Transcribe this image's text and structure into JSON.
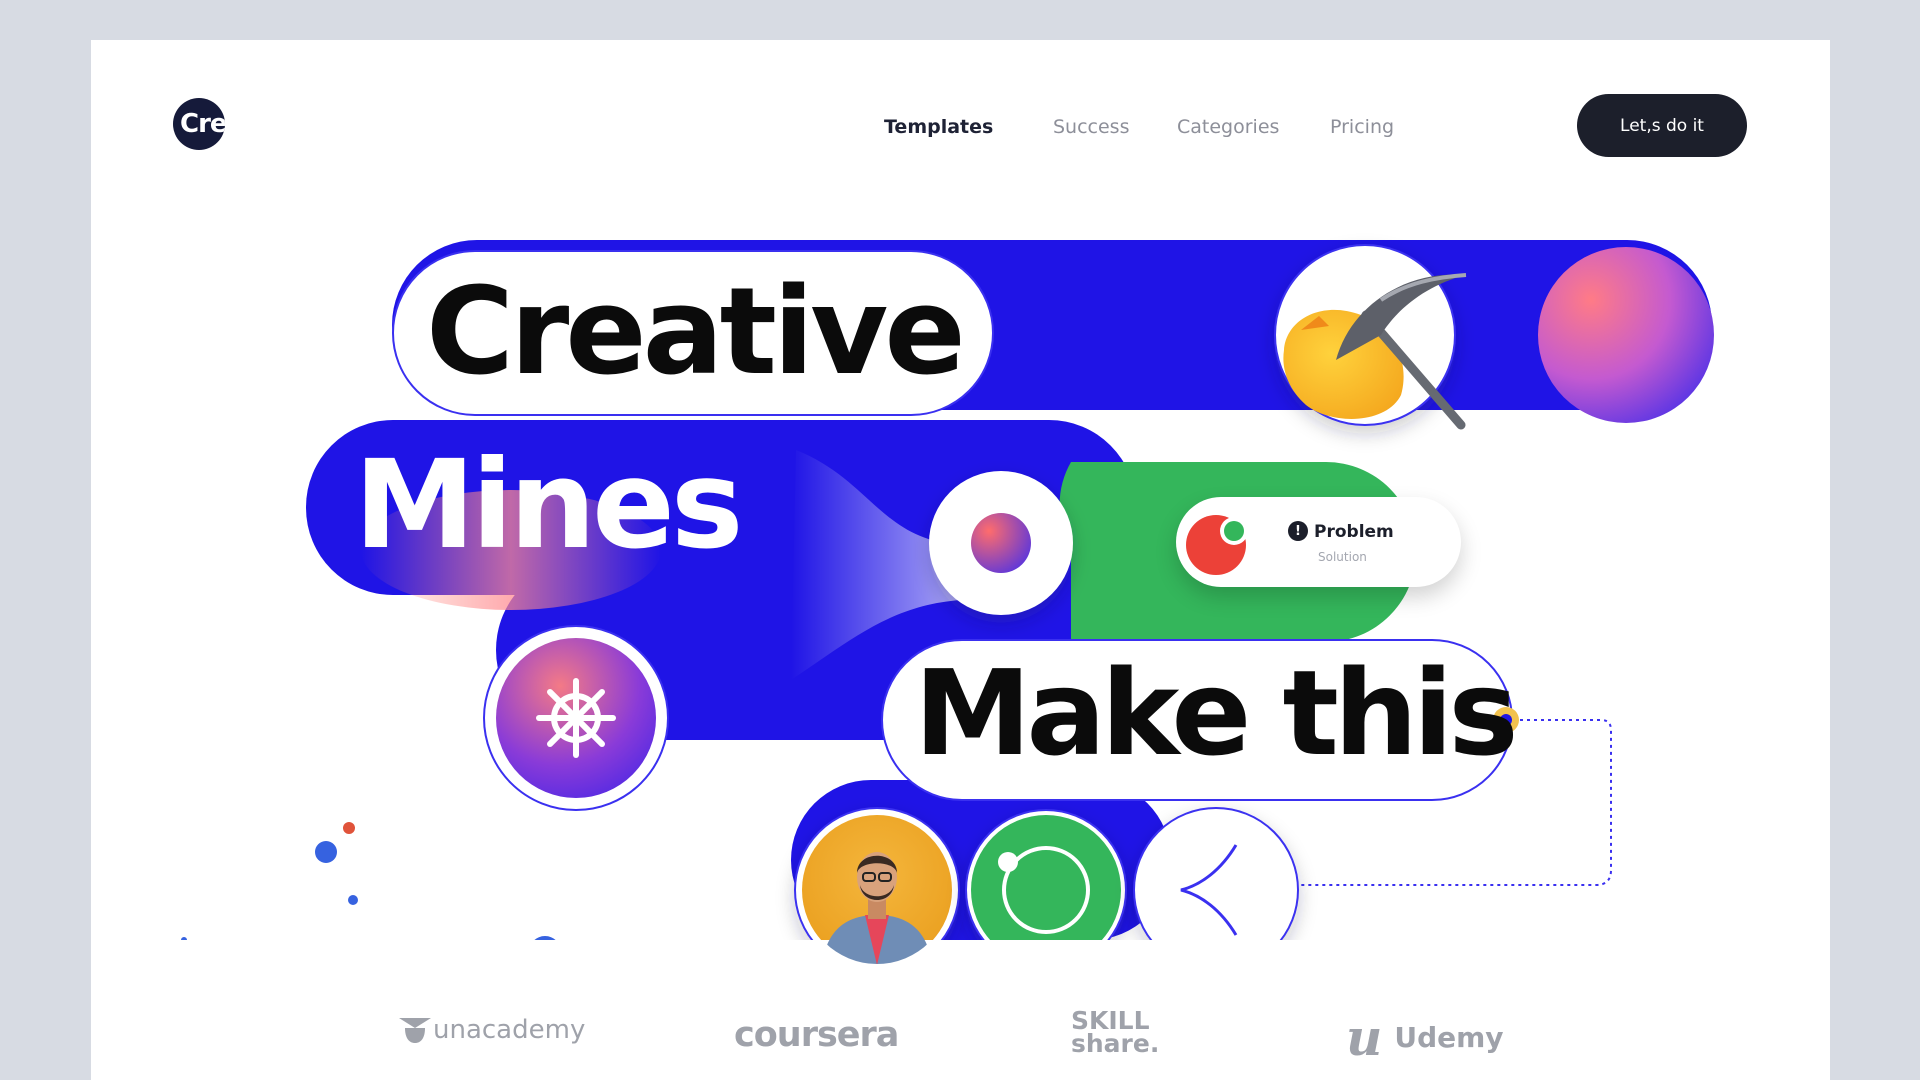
{
  "nav": {
    "logo_text": "Cre",
    "links": [
      "Templates",
      "Success",
      "Categories",
      "Pricing"
    ],
    "active": "Templates",
    "cta": "Let,s do it"
  },
  "hero": {
    "word1": "Creative",
    "word2": "Mines",
    "word3": "Make this",
    "card": {
      "title": "Problem",
      "subtitle": "Solution"
    }
  },
  "partners": [
    "unacademy",
    "coursera",
    "SKILL\nshare.",
    "Udemy"
  ],
  "colors": {
    "blue": "#1f14e6",
    "green": "#34b65b",
    "coral": "#f06a6a",
    "dark": "#1c1f2b",
    "background": "#d7dbe3"
  },
  "icons": [
    "pickaxe-icon",
    "ship-wheel-icon",
    "record-icon",
    "arrow-left-icon"
  ]
}
